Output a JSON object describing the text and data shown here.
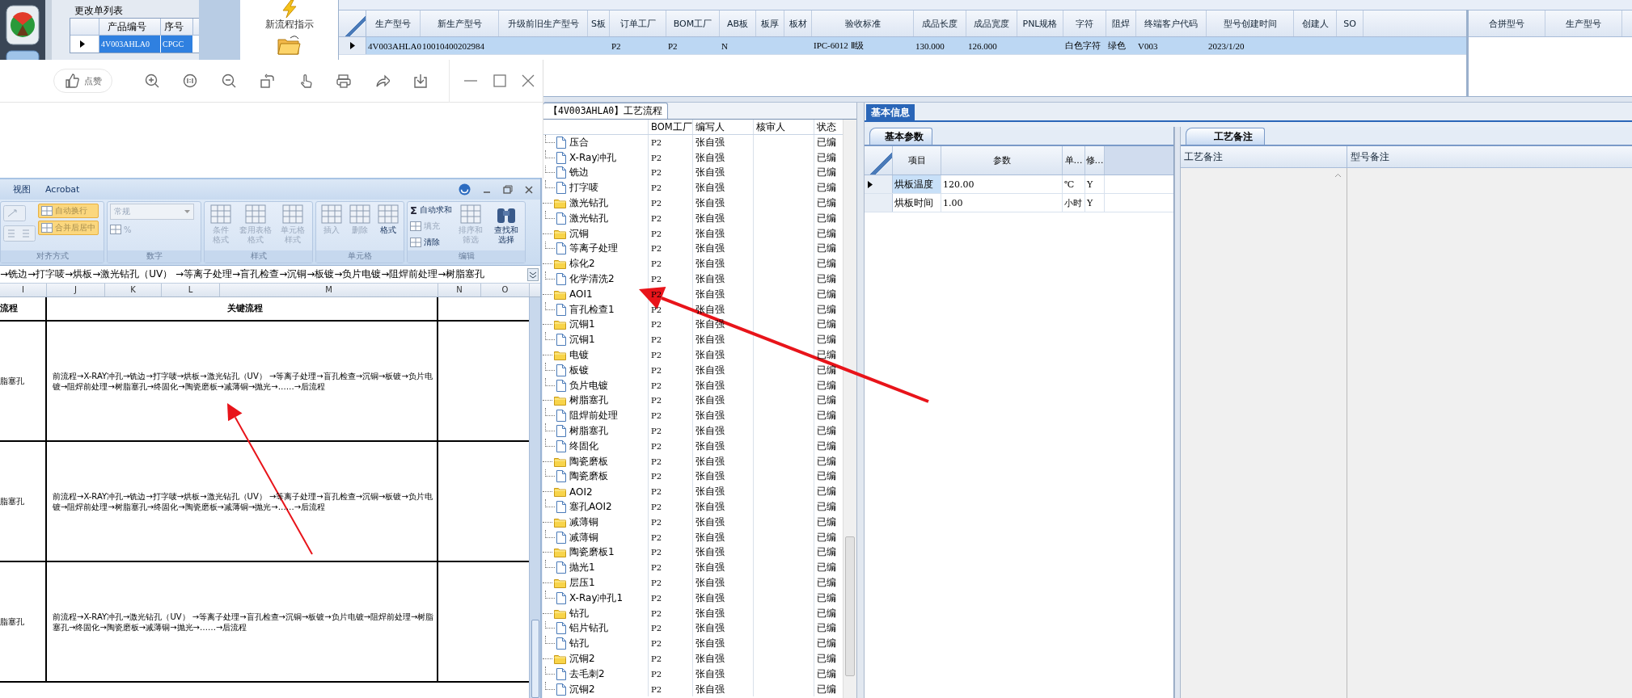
{
  "change_list": {
    "title": "更改单列表",
    "columns": [
      "产品编号",
      "序号"
    ],
    "rows": [
      {
        "cells": [
          "4V003AHLA0",
          "CPGC"
        ],
        "selected": true
      }
    ]
  },
  "tool_panel": {
    "items": [
      {
        "label": "新流程指示",
        "kind": "bolt"
      },
      {
        "kind": "folder"
      }
    ]
  },
  "main_grid": {
    "columns": [
      "生产型号",
      "新生产型号",
      "升级前旧生产型号",
      "S板",
      "订单工厂",
      "BOM工厂",
      "AB板",
      "板厚",
      "板材",
      "验收标准",
      "成品长度",
      "成品宽度",
      "PNL规格",
      "字符",
      "阻焊",
      "终端客户代码",
      "型号创建时间",
      "创建人",
      "SO"
    ],
    "rows": [
      {
        "selected": true,
        "cells": [
          "4V003AHLA0",
          "10010400202984",
          null,
          null,
          "P2",
          "P2",
          "N",
          null,
          null,
          "IPC-6012 Ⅱ级",
          "130.000",
          "126.000",
          null,
          "白色字符",
          "绿色",
          "V003",
          "2023/1/20",
          null,
          null
        ]
      }
    ]
  },
  "merge_grid": {
    "columns": [
      "合拼型号",
      "生产型号"
    ]
  },
  "image_viewer": {
    "like_label": "点赞"
  },
  "excel": {
    "tabs": [
      "视图",
      "Acrobat"
    ],
    "ribbon_groups": [
      {
        "label": "对齐方式",
        "buttons": [
          {
            "kind": "small",
            "label": "自动换行",
            "disabled": true,
            "active": true
          },
          {
            "kind": "small",
            "label": "合并后居中",
            "disabled": true,
            "active": true
          }
        ]
      },
      {
        "label": "数字",
        "buttons": [
          {
            "kind": "dropdown",
            "label": "常规",
            "disabled": true,
            "active": false
          },
          {
            "kind": "small",
            "label": "%",
            "disabled": true,
            "active": false
          }
        ]
      },
      {
        "label": "样式",
        "buttons": [
          {
            "kind": "large",
            "label": "条件格式",
            "disabled": true,
            "active": false
          },
          {
            "kind": "large",
            "label": "套用表格格式",
            "disabled": true,
            "active": false
          },
          {
            "kind": "large",
            "label": "单元格样式",
            "disabled": true,
            "active": false
          }
        ]
      },
      {
        "label": "单元格",
        "buttons": [
          {
            "kind": "large",
            "label": "插入",
            "disabled": true,
            "active": false
          },
          {
            "kind": "large",
            "label": "删除",
            "disabled": true,
            "active": false
          },
          {
            "kind": "large",
            "label": "格式",
            "disabled": false,
            "active": false
          }
        ]
      },
      {
        "label": "编辑",
        "buttons": [
          {
            "kind": "small",
            "label": "自动求和",
            "icon": "Σ",
            "disabled": false,
            "active": false
          },
          {
            "kind": "small",
            "label": "填充",
            "disabled": true,
            "active": false
          },
          {
            "kind": "small",
            "label": "清除",
            "disabled": false,
            "active": false
          },
          {
            "kind": "large",
            "label": "排序和筛选",
            "disabled": true,
            "active": false
          },
          {
            "kind": "large",
            "label": "查找和选择",
            "disabled": false,
            "active": false
          }
        ]
      }
    ],
    "formula": "→铣边→打字唛→烘板→激光钻孔（UV） →等离子处理→盲孔检查→沉铜→板镀→负片电镀→阻焊前处理→树脂塞孔",
    "column_headers": [
      "I",
      "J",
      "K",
      "L",
      "M",
      "N",
      "O"
    ],
    "table": {
      "header": [
        "流程",
        "关键流程"
      ],
      "rows": [
        [
          "脂塞孔",
          "前流程→X-RAY冲孔→铣边→打字唛→烘板→激光钻孔（UV） →等离子处理→盲孔检查→沉铜→板镀→负片电镀→阻焊前处理→树脂塞孔→终固化→陶瓷磨板→减薄铜→抛光→……→后流程"
        ],
        [
          "脂塞孔",
          "前流程→X-RAY冲孔→铣边→打字唛→烘板→激光钻孔（UV） →等离子处理→盲孔检查→沉铜→板镀→负片电镀→阻焊前处理→树脂塞孔→终固化→陶瓷磨板→减薄铜→抛光→……→后流程"
        ],
        [
          "脂塞孔",
          "前流程→X-RAY冲孔→激光钻孔（UV） →等离子处理→盲孔检查→沉铜→板镀→负片电镀→阻焊前处理→树脂塞孔→终固化→陶瓷磨板→减薄铜→抛光→……→后流程"
        ]
      ]
    }
  },
  "process_tree": {
    "tab": "【4V003AHLA0】工艺流程",
    "columns": [
      "BOM工厂",
      "编写人",
      "核审人",
      "状态"
    ],
    "rows": [
      {
        "children": [
          {
            "label": "压合",
            "bom_factory": "P2",
            "author": "张自强",
            "status": "已编"
          },
          {
            "label": "X-Ray冲孔",
            "bom_factory": "P2",
            "author": "张自强",
            "status": "已编"
          },
          {
            "label": "铣边",
            "bom_factory": "P2",
            "author": "张自强",
            "status": "已编"
          },
          {
            "label": "打字唛",
            "bom_factory": "P2",
            "author": "张自强",
            "status": "已编"
          }
        ]
      },
      {
        "label": "激光钻孔",
        "bom_factory": "P2",
        "author": "张自强",
        "status": "已编",
        "children": [
          {
            "label": "激光钻孔",
            "bom_factory": "P2",
            "author": "张自强",
            "status": "已编"
          }
        ]
      },
      {
        "label": "沉铜",
        "bom_factory": "P2",
        "author": "张自强",
        "status": "已编",
        "children": [
          {
            "label": "等离子处理",
            "bom_factory": "P2",
            "author": "张自强",
            "status": "已编"
          }
        ]
      },
      {
        "label": "棕化2",
        "bom_factory": "P2",
        "author": "张自强",
        "status": "已编",
        "children": [
          {
            "label": "化学清洗2",
            "bom_factory": "P2",
            "author": "张自强",
            "status": "已编"
          }
        ]
      },
      {
        "label": "AOI1",
        "bom_factory": "P2",
        "author": "张自强",
        "status": "已编",
        "children": [
          {
            "label": "盲孔检查1",
            "bom_factory": "P2",
            "author": "张自强",
            "status": "已编"
          }
        ]
      },
      {
        "label": "沉铜1",
        "bom_factory": "P2",
        "author": "张自强",
        "status": "已编",
        "children": [
          {
            "label": "沉铜1",
            "bom_factory": "P2",
            "author": "张自强",
            "status": "已编"
          }
        ]
      },
      {
        "label": "电镀",
        "bom_factory": "P2",
        "author": "张自强",
        "status": "已编",
        "children": [
          {
            "label": "板镀",
            "bom_factory": "P2",
            "author": "张自强",
            "status": "已编"
          },
          {
            "label": "负片电镀",
            "bom_factory": "P2",
            "author": "张自强",
            "status": "已编"
          }
        ]
      },
      {
        "label": "树脂塞孔",
        "bom_factory": "P2",
        "author": "张自强",
        "status": "已编",
        "children": [
          {
            "label": "阻焊前处理",
            "bom_factory": "P2",
            "author": "张自强",
            "status": "已编"
          },
          {
            "label": "树脂塞孔",
            "bom_factory": "P2",
            "author": "张自强",
            "status": "已编"
          },
          {
            "label": "终固化",
            "bom_factory": "P2",
            "author": "张自强",
            "status": "已编"
          }
        ]
      },
      {
        "label": "陶瓷磨板",
        "bom_factory": "P2",
        "author": "张自强",
        "status": "已编",
        "children": [
          {
            "label": "陶瓷磨板",
            "bom_factory": "P2",
            "author": "张自强",
            "status": "已编"
          }
        ]
      },
      {
        "label": "AOI2",
        "bom_factory": "P2",
        "author": "张自强",
        "status": "已编",
        "children": [
          {
            "label": "塞孔AOI2",
            "bom_factory": "P2",
            "author": "张自强",
            "status": "已编"
          }
        ]
      },
      {
        "label": "减薄铜",
        "bom_factory": "P2",
        "author": "张自强",
        "status": "已编",
        "children": [
          {
            "label": "减薄铜",
            "bom_factory": "P2",
            "author": "张自强",
            "status": "已编"
          }
        ]
      },
      {
        "label": "陶瓷磨板1",
        "bom_factory": "P2",
        "author": "张自强",
        "status": "已编",
        "children": [
          {
            "label": "抛光1",
            "bom_factory": "P2",
            "author": "张自强",
            "status": "已编"
          }
        ]
      },
      {
        "label": "层压1",
        "bom_factory": "P2",
        "author": "张自强",
        "status": "已编",
        "children": [
          {
            "label": "X-Ray冲孔1",
            "bom_factory": "P2",
            "author": "张自强",
            "status": "已编"
          }
        ]
      },
      {
        "label": "钻孔",
        "bom_factory": "P2",
        "author": "张自强",
        "status": "已编",
        "children": [
          {
            "label": "铝片钻孔",
            "bom_factory": "P2",
            "author": "张自强",
            "status": "已编"
          },
          {
            "label": "钻孔",
            "bom_factory": "P2",
            "author": "张自强",
            "status": "已编"
          }
        ]
      },
      {
        "label": "沉铜2",
        "bom_factory": "P2",
        "author": "张自强",
        "status": "已编",
        "children": [
          {
            "label": "去毛刺2",
            "bom_factory": "P2",
            "author": "张自强",
            "status": "已编"
          },
          {
            "label": "沉铜2",
            "bom_factory": "P2",
            "author": "张自强",
            "status": "已编"
          }
        ]
      }
    ]
  },
  "basic_info": {
    "tab": "基本信息",
    "sub_tab": "基本参数",
    "columns": [
      "项目",
      "参数",
      "单…",
      "修…"
    ],
    "rows": [
      {
        "selected": true,
        "cells": [
          "烘板温度",
          "120.00",
          "℃",
          "Y"
        ]
      },
      {
        "selected": false,
        "cells": [
          "烘板时间",
          "1.00",
          "小时",
          "Y"
        ]
      }
    ]
  },
  "remarks": {
    "tab": "工艺备注",
    "columns": [
      "工艺备注",
      "型号备注"
    ]
  },
  "annotations": [
    {
      "kind": "arrow"
    },
    {
      "kind": "arrow"
    }
  ]
}
